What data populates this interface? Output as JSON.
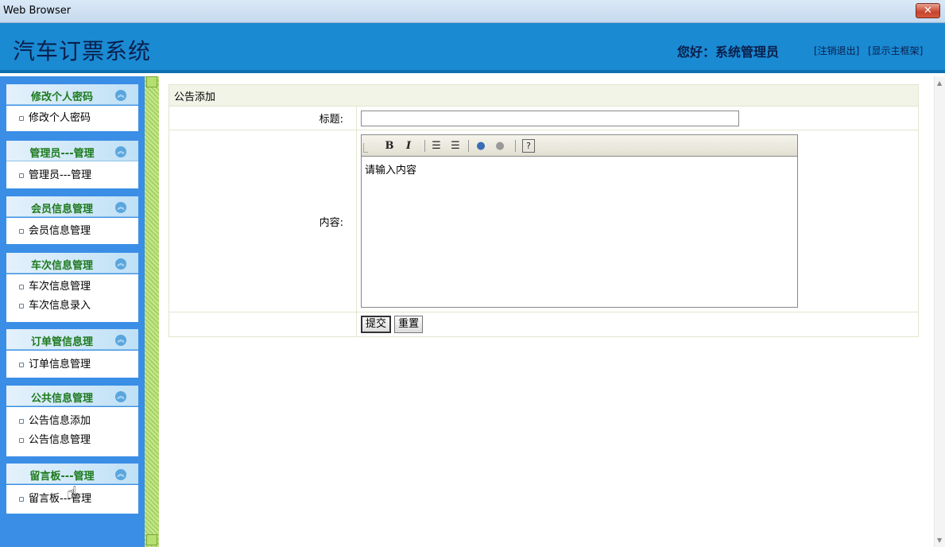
{
  "window": {
    "title": "Web Browser",
    "close_glyph": "✕"
  },
  "header": {
    "system_title": "汽车订票系统",
    "greeting": "您好：系统管理员",
    "logout_link": "[注销退出]",
    "main_frame_link": "[显示主框架]"
  },
  "sidebar": {
    "groups": [
      {
        "title": "修改个人密码",
        "items": [
          "修改个人密码"
        ]
      },
      {
        "title": "管理员---管理",
        "items": [
          "管理员---管理"
        ]
      },
      {
        "title": "会员信息管理",
        "items": [
          "会员信息管理"
        ]
      },
      {
        "title": "车次信息管理",
        "items": [
          "车次信息管理",
          "车次信息录入"
        ]
      },
      {
        "title": "订单管信息理",
        "items": [
          "订单信息管理"
        ]
      },
      {
        "title": "公共信息管理",
        "items": [
          "公告信息添加",
          "公告信息管理"
        ]
      },
      {
        "title": "留言板---管理",
        "items": [
          "留言板---管理"
        ]
      }
    ],
    "collapse_glyph": "︽"
  },
  "form": {
    "heading": "公告添加",
    "title_label": "标题:",
    "title_value": "",
    "content_label": "内容:",
    "editor": {
      "placeholder_text": "请输入内容",
      "toolbar": [
        "drag-handle-icon",
        "bold-icon",
        "italic-icon",
        "ordered-list-icon",
        "unordered-list-icon",
        "insert-link-icon",
        "remove-link-icon",
        "help-icon"
      ]
    },
    "submit_label": "提交",
    "reset_label": "重置"
  }
}
